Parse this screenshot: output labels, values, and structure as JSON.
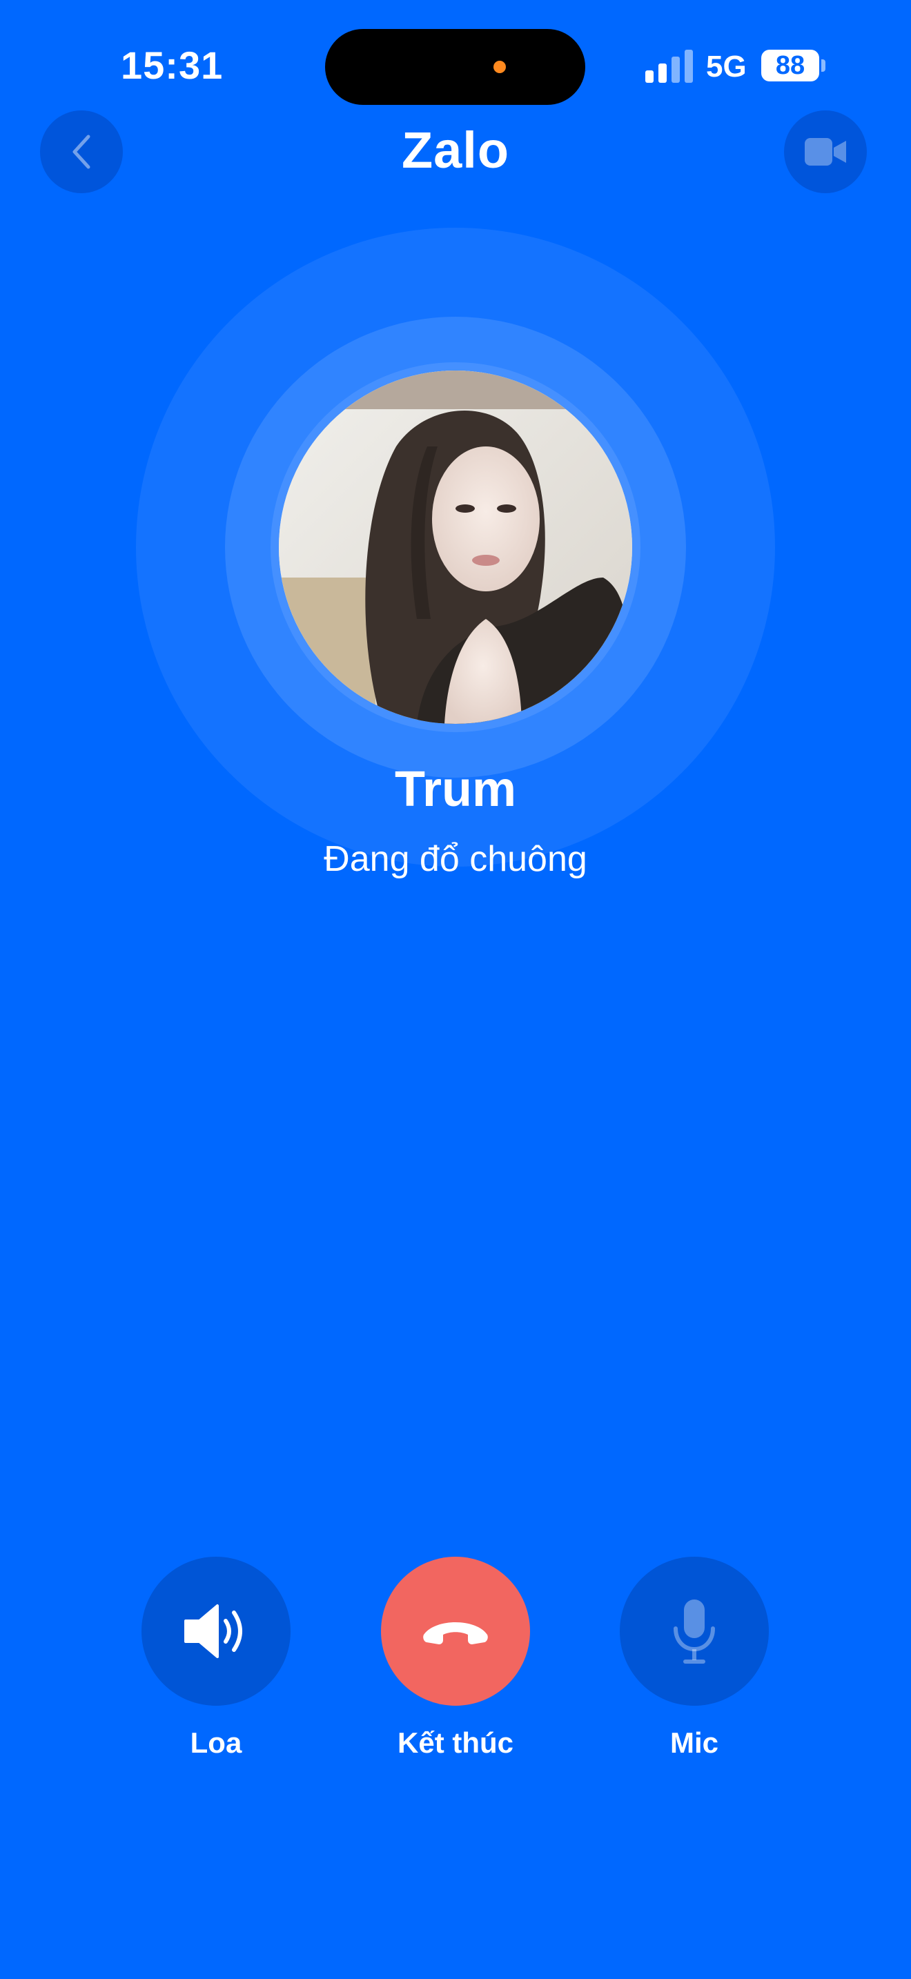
{
  "status_bar": {
    "time": "15:31",
    "network": "5G",
    "battery": "88"
  },
  "header": {
    "title": "Zalo",
    "back_icon": "chevron-left-icon",
    "video_icon": "video-camera-icon"
  },
  "call": {
    "caller_name": "Trum",
    "status": "Đang đổ chuông"
  },
  "controls": {
    "speaker_label": "Loa",
    "end_label": "Kết thúc",
    "mic_label": "Mic"
  },
  "colors": {
    "background": "#0068FF",
    "end_call": "#F26660",
    "control_bg": "#0055D6"
  }
}
